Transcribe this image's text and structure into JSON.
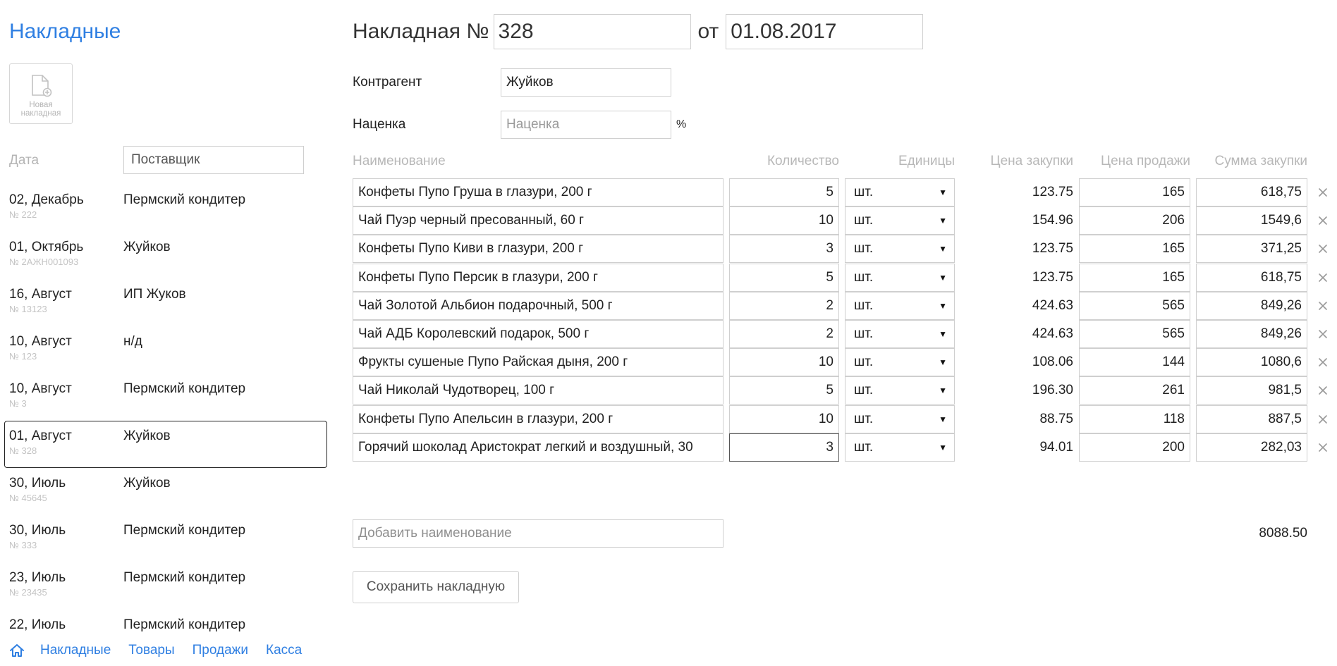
{
  "colors": {
    "accent": "#2f7fe2",
    "muted": "#b8b8b8",
    "border": "#cfcfcf"
  },
  "sidebar": {
    "title": "Накладные",
    "new_button_label": "Новая накладная",
    "new_button_icon": "new-document-icon",
    "filter": {
      "date_label": "Дата",
      "supplier_placeholder": "Поставщик"
    },
    "invoices": [
      {
        "date": "02, Декабрь",
        "number": "№ 222",
        "supplier": "Пермский кондитер",
        "active": false
      },
      {
        "date": "01, Октябрь",
        "number": "№ 2АЖН001093",
        "supplier": "Жуйков",
        "active": false
      },
      {
        "date": "16, Август",
        "number": "№ 13123",
        "supplier": "ИП Жуков",
        "active": false
      },
      {
        "date": "10, Август",
        "number": "№ 123",
        "supplier": "н/д",
        "active": false
      },
      {
        "date": "10, Август",
        "number": "№ 3",
        "supplier": "Пермский кондитер",
        "active": false
      },
      {
        "date": "01, Август",
        "number": "№ 328",
        "supplier": "Жуйков",
        "active": true
      },
      {
        "date": "30, Июль",
        "number": "№ 45645",
        "supplier": "Жуйков",
        "active": false
      },
      {
        "date": "30, Июль",
        "number": "№ 333",
        "supplier": "Пермский кондитер",
        "active": false
      },
      {
        "date": "23, Июль",
        "number": "№ 23435",
        "supplier": "Пермский кондитер",
        "active": false
      },
      {
        "date": "22, Июль",
        "number": "",
        "supplier": "Пермский кондитер",
        "active": false
      }
    ]
  },
  "bottom_nav": {
    "home_icon": "home-icon",
    "links": [
      "Накладные",
      "Товары",
      "Продажи",
      "Касса"
    ]
  },
  "invoice": {
    "title_label": "Накладная №",
    "number": "328",
    "date_sep": "от",
    "date": "01.08.2017",
    "counterparty_label": "Контрагент",
    "counterparty": "Жуйков",
    "markup_label": "Наценка",
    "markup_placeholder": "Наценка",
    "markup_suffix": "%",
    "columns": {
      "name": "Наименование",
      "qty": "Количество",
      "unit": "Единицы",
      "buy_price": "Цена закупки",
      "sell_price": "Цена продажи",
      "sum": "Сумма закупки"
    },
    "items": [
      {
        "name": "Конфеты Пупо Груша в глазури, 200 г",
        "qty": "5",
        "unit": "шт.",
        "buy": "123.75",
        "sell": "165",
        "sum": "618,75"
      },
      {
        "name": "Чай Пуэр черный пресованный, 60 г",
        "qty": "10",
        "unit": "шт.",
        "buy": "154.96",
        "sell": "206",
        "sum": "1549,6"
      },
      {
        "name": "Конфеты Пупо Киви в глазури, 200 г",
        "qty": "3",
        "unit": "шт.",
        "buy": "123.75",
        "sell": "165",
        "sum": "371,25"
      },
      {
        "name": "Конфеты Пупо Персик в глазури, 200 г",
        "qty": "5",
        "unit": "шт.",
        "buy": "123.75",
        "sell": "165",
        "sum": "618,75"
      },
      {
        "name": "Чай Золотой Альбион подарочный, 500 г",
        "qty": "2",
        "unit": "шт.",
        "buy": "424.63",
        "sell": "565",
        "sum": "849,26"
      },
      {
        "name": "Чай АДБ Королевский подарок, 500 г",
        "qty": "2",
        "unit": "шт.",
        "buy": "424.63",
        "sell": "565",
        "sum": "849,26"
      },
      {
        "name": "Фрукты сушеные Пупо Райская дыня, 200 г",
        "qty": "10",
        "unit": "шт.",
        "buy": "108.06",
        "sell": "144",
        "sum": "1080,6"
      },
      {
        "name": "Чай Николай Чудотворец, 100 г",
        "qty": "5",
        "unit": "шт.",
        "buy": "196.30",
        "sell": "261",
        "sum": "981,5"
      },
      {
        "name": "Конфеты Пупо Апельсин в глазури, 200 г",
        "qty": "10",
        "unit": "шт.",
        "buy": "88.75",
        "sell": "118",
        "sum": "887,5"
      },
      {
        "name": "Горячий шоколад Аристократ легкий и воздушный, 30",
        "qty": "3",
        "unit": "шт.",
        "buy": "94.01",
        "sell": "200",
        "sum": "282,03"
      }
    ],
    "add_placeholder": "Добавить наименование",
    "total": "8088.50",
    "save_label": "Сохранить накладную"
  }
}
